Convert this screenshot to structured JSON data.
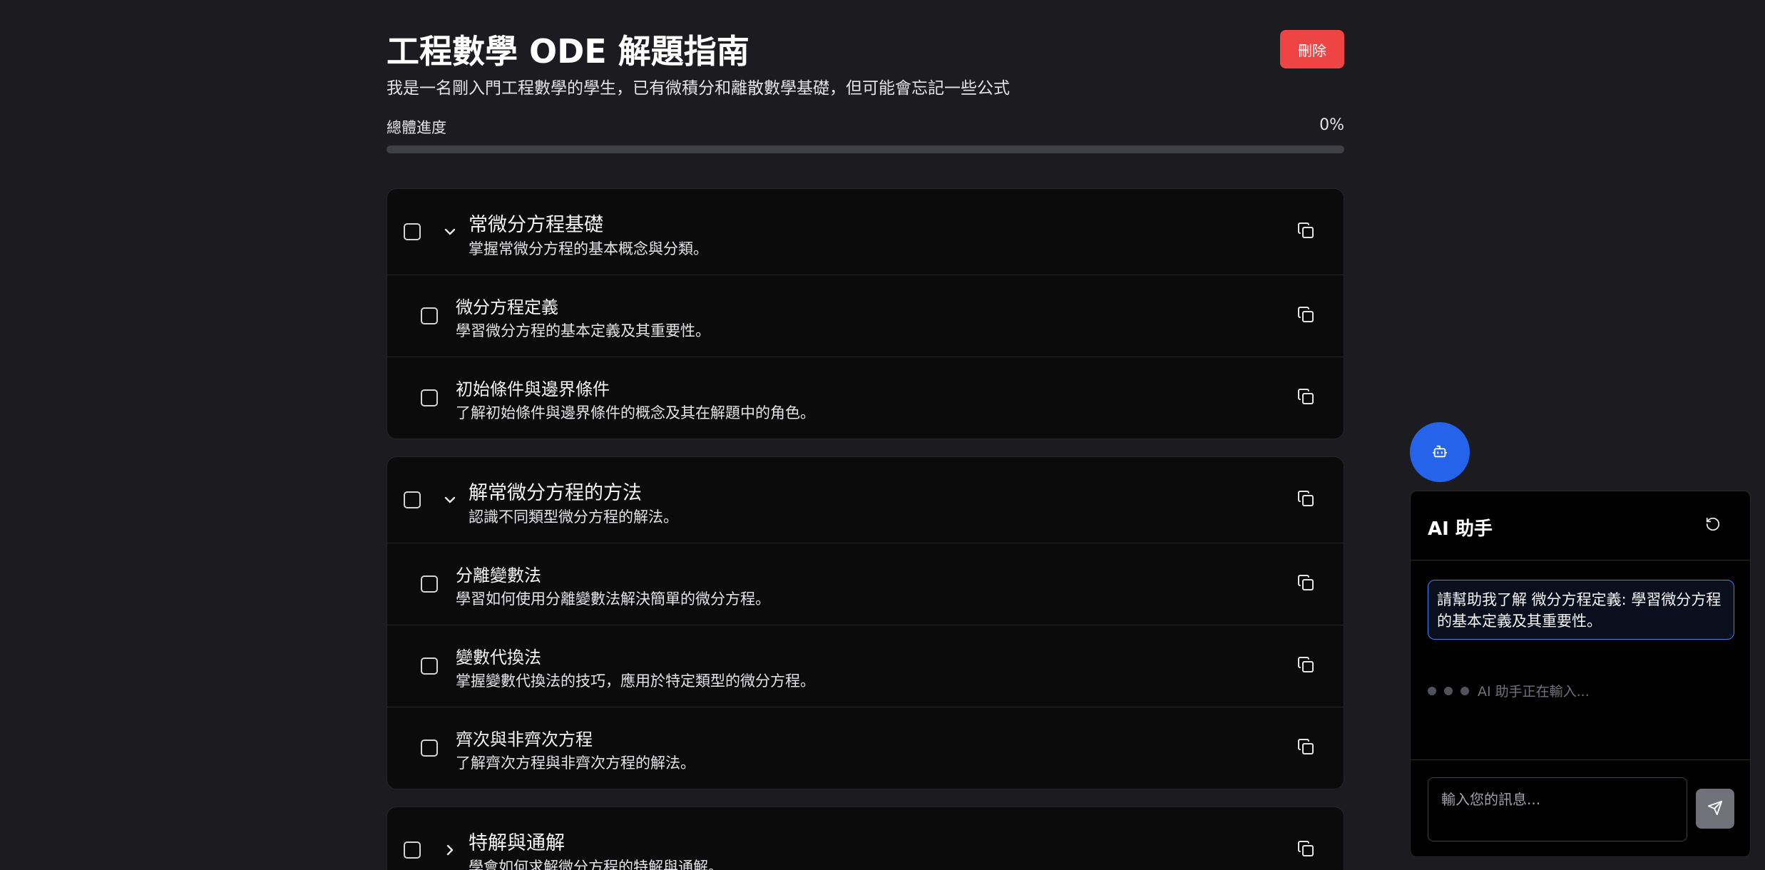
{
  "guide": {
    "title": "工程數學 ODE 解題指南",
    "subtitle": "我是一名剛入門工程數學的學生，已有微積分和離散數學基礎，但可能會忘記一些公式",
    "delete_label": "刪除",
    "progress_label": "總體進度",
    "progress_text": "0%",
    "progress_value": 0
  },
  "sections": [
    {
      "title": "常微分方程基礎",
      "desc": "掌握常微分方程的基本概念與分類。",
      "expanded": true,
      "children": [
        {
          "title": "微分方程定義",
          "desc": "學習微分方程的基本定義及其重要性。"
        },
        {
          "title": "初始條件與邊界條件",
          "desc": "了解初始條件與邊界條件的概念及其在解題中的角色。"
        }
      ]
    },
    {
      "title": "解常微分方程的方法",
      "desc": "認識不同類型微分方程的解法。",
      "expanded": true,
      "children": [
        {
          "title": "分離變數法",
          "desc": "學習如何使用分離變數法解決簡單的微分方程。"
        },
        {
          "title": "變數代換法",
          "desc": "掌握變數代換法的技巧，應用於特定類型的微分方程。"
        },
        {
          "title": "齊次與非齊次方程",
          "desc": "了解齊次方程與非齊次方程的解法。"
        }
      ]
    },
    {
      "title": "特解與通解",
      "desc": "學會如何求解微分方程的特解與通解。",
      "expanded": false,
      "children": []
    }
  ],
  "assistant": {
    "title": "AI 助手",
    "user_message": "請幫助我了解 微分方程定義: 學習微分方程的基本定義及其重要性。",
    "typing_text": "AI 助手正在輸入...",
    "input_placeholder": "輸入您的訊息..."
  },
  "colors": {
    "accent": "#2563eb",
    "danger": "#ef4444",
    "background": "#1c1c20"
  },
  "icons": {
    "copy": "copy-icon",
    "expand": "chevron-down-icon",
    "collapse": "chevron-right-icon",
    "bot": "bot-icon",
    "reset": "rotate-ccw-icon",
    "send": "send-icon"
  }
}
